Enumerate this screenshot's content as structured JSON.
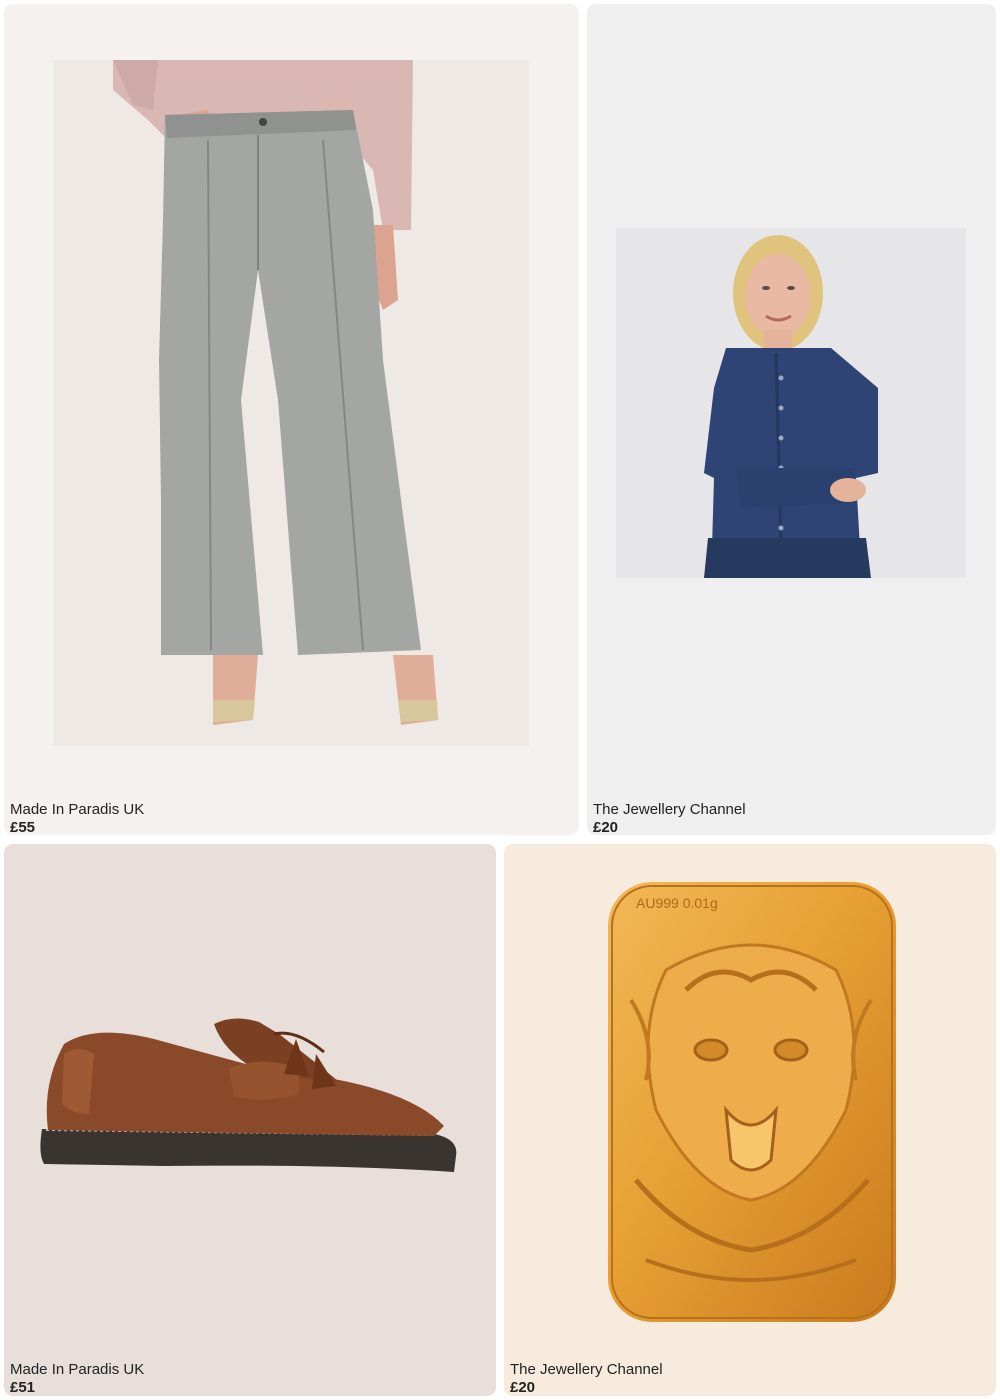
{
  "products": [
    {
      "brand": "Made In Paradis UK",
      "price": "£55",
      "image_icon": "grey-wide-leg-jeans",
      "background": "#f5f1ef"
    },
    {
      "brand": "The Jewellery Channel",
      "price": "£20",
      "image_icon": "navy-cardigan",
      "background": "#efeff0"
    },
    {
      "brand": "Made In Paradis UK",
      "price": "£51",
      "image_icon": "tan-tassel-loafer",
      "background": "#e8dfdb"
    },
    {
      "brand": "The Jewellery Channel",
      "price": "£20",
      "image_icon": "gold-dragon-bar",
      "background": "#f6ebdd"
    }
  ],
  "product_images": {
    "ingot_stamp": "AU999 0.01g"
  }
}
